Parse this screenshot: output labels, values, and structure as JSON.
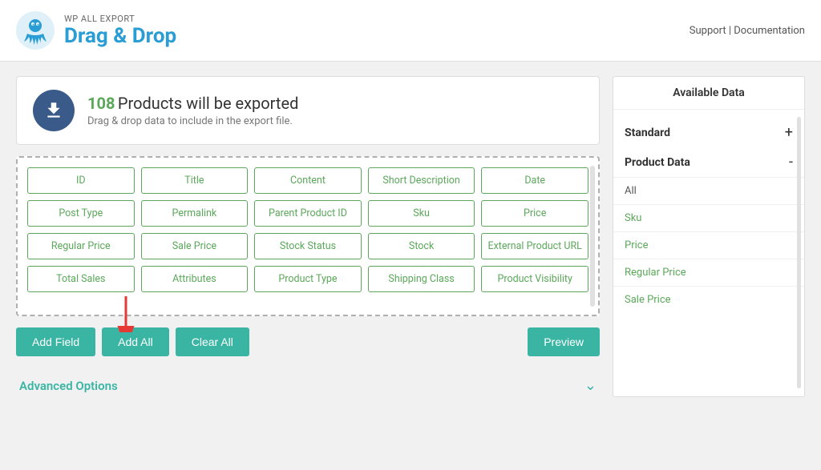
{
  "header": {
    "brand": "WP ALL EXPORT",
    "title": "Drag & Drop",
    "support_link": "Support",
    "doc_separator": " | ",
    "doc_link": "Documentation"
  },
  "banner": {
    "count": "108",
    "title": " Products will be exported",
    "subtitle": "Drag & drop data to include in the export file."
  },
  "fields": [
    "ID",
    "Title",
    "Content",
    "Short Description",
    "Date",
    "Post Type",
    "Permalink",
    "Parent Product ID",
    "Sku",
    "Price",
    "Regular Price",
    "Sale Price",
    "Stock Status",
    "Stock",
    "External Product URL",
    "Total Sales",
    "Attributes",
    "Product Type",
    "Shipping Class",
    "Product Visibility"
  ],
  "buttons": {
    "add_field": "Add Field",
    "add_all": "Add All",
    "clear_all": "Clear All",
    "preview": "Preview"
  },
  "advanced_options": {
    "label": "Advanced Options"
  },
  "right_panel": {
    "title": "Available Data",
    "sections": [
      {
        "name": "Standard",
        "toggle": "+",
        "items": []
      },
      {
        "name": "Product Data",
        "toggle": "-",
        "items": [
          {
            "label": "All",
            "style": "normal"
          },
          {
            "label": "Sku",
            "style": "green"
          },
          {
            "label": "Price",
            "style": "green"
          },
          {
            "label": "Regular Price",
            "style": "green"
          },
          {
            "label": "Sale Price",
            "style": "green"
          }
        ]
      }
    ]
  }
}
